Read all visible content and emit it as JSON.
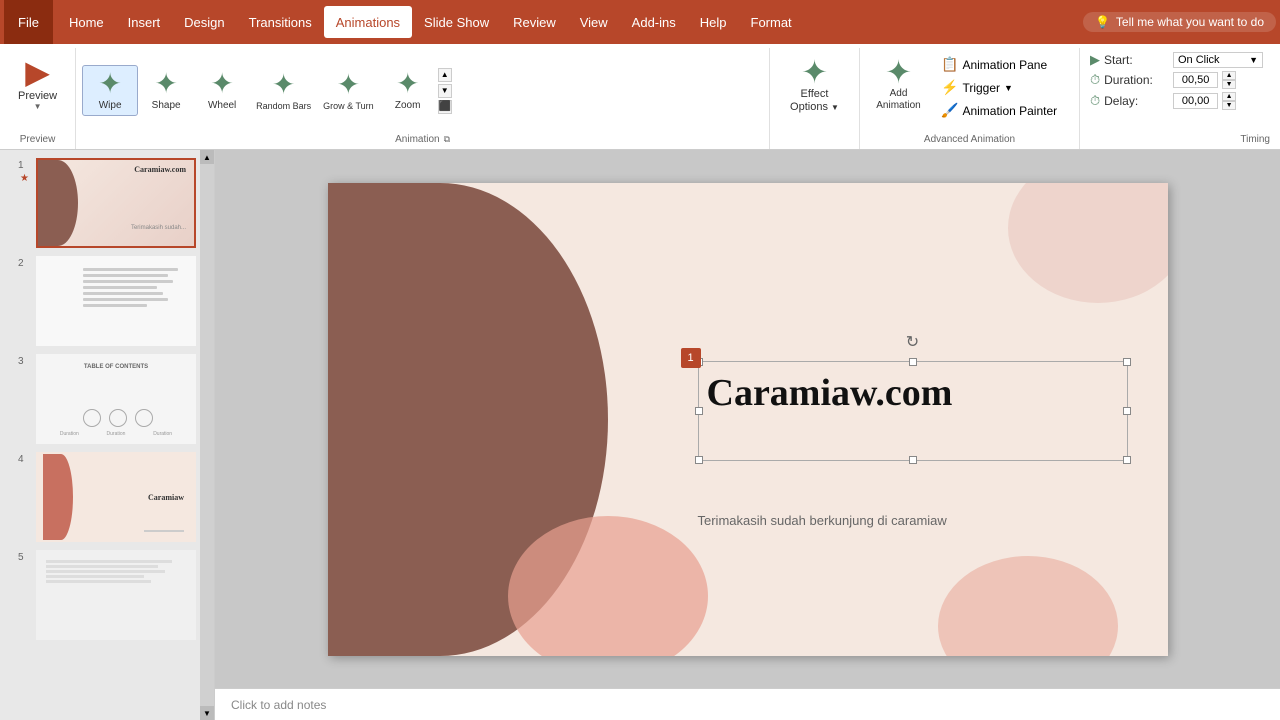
{
  "tabs": {
    "file": "File",
    "home": "Home",
    "insert": "Insert",
    "design": "Design",
    "transitions": "Transitions",
    "animations": "Animations",
    "slideshow": "Slide Show",
    "review": "Review",
    "view": "View",
    "addins": "Add-ins",
    "help": "Help",
    "format": "Format"
  },
  "tell_me": "Tell me what you want to do",
  "preview": {
    "label": "Preview",
    "sublabel": "Preview"
  },
  "animations": {
    "group_label": "Animation",
    "items": [
      {
        "id": "wipe",
        "label": "Wipe",
        "selected": true
      },
      {
        "id": "shape",
        "label": "Shape",
        "selected": false
      },
      {
        "id": "wheel",
        "label": "Wheel",
        "selected": false
      },
      {
        "id": "random_bars",
        "label": "Random Bars",
        "selected": false
      },
      {
        "id": "grow_turn",
        "label": "Grow & Turn",
        "selected": false
      },
      {
        "id": "zoom",
        "label": "Zoom",
        "selected": false
      }
    ]
  },
  "effect_options": {
    "label": "Effect",
    "label2": "Options",
    "dropdown": "▼"
  },
  "advanced": {
    "group_label": "Advanced Animation",
    "add_animation": "Add\nAnimation",
    "animation_pane": "Animation Pane",
    "trigger": "Trigger",
    "trigger_dropdown": "▼",
    "animation_painter": "Animation Painter"
  },
  "timing": {
    "group_label": "Timing",
    "start_label": "Start:",
    "start_value": "On Click",
    "duration_label": "Duration:",
    "duration_value": "00,50",
    "delay_label": "Delay:",
    "delay_value": "00,00"
  },
  "slides": [
    {
      "num": "1",
      "star": "★",
      "active": true
    },
    {
      "num": "2",
      "star": "",
      "active": false
    },
    {
      "num": "3",
      "star": "",
      "active": false
    },
    {
      "num": "4",
      "star": "",
      "active": false
    },
    {
      "num": "5",
      "star": "",
      "active": false
    }
  ],
  "canvas": {
    "main_text": "Caramiaw.com",
    "subtitle": "Terimakasih sudah berkunjung di caramiaw",
    "animation_number": "1"
  },
  "notes": {
    "placeholder": "Click to add notes"
  }
}
